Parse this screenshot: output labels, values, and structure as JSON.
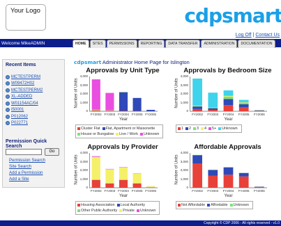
{
  "logo": {
    "text": "Your Logo"
  },
  "brand": {
    "name": "cdpsmart"
  },
  "toplinks": {
    "logoff": "Log Off",
    "separator": "|",
    "contact": "Contact Us"
  },
  "welcome": "Welcome MikeADMIN",
  "tabs": [
    "HOME",
    "SITES",
    "PERMISSIONS",
    "REPORTING",
    "DATA TRANSFER",
    "ADMINISTRATION",
    "DOCUMENTATION"
  ],
  "sidebar": {
    "recent_title": "Recent Items",
    "recent": [
      "MCTESTPERM",
      "W09472H02",
      "MCTESTPERM2",
      "XL-ADDED",
      "W01154AC/04",
      "I50001",
      "P012062",
      "P022771"
    ],
    "pqs_title": "Permission Quick Search",
    "pqs_input_value": "",
    "go_label": "Go",
    "links": [
      "Permission Search",
      "Site Search",
      "Add a Permission",
      "Add a Site"
    ]
  },
  "main": {
    "title_brand": "cdpsmart",
    "title_text": " Administrator Home Page for Islington"
  },
  "colors": {
    "nav": "#0c1e8c",
    "brand": "#1aa0e8",
    "pink": "#e94ee0",
    "blue": "#2f49b8",
    "cyan": "#3fd3ec",
    "yellow": "#f5f06a",
    "green": "#7fe07a",
    "red": "#e8413a"
  },
  "chart_data": [
    {
      "type": "bar",
      "stacked": true,
      "title": "Approvals by Unit Type",
      "xlabel": "Year",
      "ylabel": "Number of Units",
      "ylim": [
        0,
        4000
      ],
      "yticks": [
        "4,000",
        "3,000",
        "2,000",
        "1,000",
        "0"
      ],
      "categories": [
        "FY2002",
        "FY2003",
        "FY2004",
        "FY2005",
        "FY2006"
      ],
      "series": [
        {
          "name": "Cluster Flat",
          "color": "#e8413a",
          "values": [
            100,
            60,
            40,
            30,
            10
          ]
        },
        {
          "name": "Flat, Apartment or Maisonette",
          "color": "#2f49b8",
          "values": [
            0,
            0,
            2150,
            1500,
            150
          ]
        },
        {
          "name": "House or Bungalow",
          "color": "#7fe07a",
          "values": [
            50,
            40,
            30,
            20,
            10
          ]
        },
        {
          "name": "Live / Work",
          "color": "#f5f06a",
          "values": [
            20,
            10,
            10,
            10,
            0
          ]
        },
        {
          "name": "Unknown",
          "color": "#e94ee0",
          "values": [
            3500,
            2000,
            0,
            0,
            0
          ]
        }
      ]
    },
    {
      "type": "bar",
      "stacked": true,
      "title": "Approvals by Bedroom Size",
      "xlabel": "Year",
      "ylabel": "Number of Units",
      "ylim": [
        0,
        4000
      ],
      "yticks": [
        "4,000",
        "3,000",
        "2,000",
        "1,000",
        "0"
      ],
      "categories": [
        "FY2002",
        "FY2003",
        "FY2004",
        "FY2005",
        "FY2006"
      ],
      "series": [
        {
          "name": "1",
          "color": "#e8413a",
          "values": [
            250,
            150,
            700,
            450,
            50
          ]
        },
        {
          "name": "2",
          "color": "#2f49b8",
          "values": [
            300,
            200,
            700,
            350,
            40
          ]
        },
        {
          "name": "3",
          "color": "#7fe07a",
          "values": [
            80,
            60,
            300,
            200,
            20
          ]
        },
        {
          "name": "4",
          "color": "#f5f06a",
          "values": [
            20,
            20,
            80,
            50,
            10
          ]
        },
        {
          "name": "5+",
          "color": "#e94ee0",
          "values": [
            10,
            10,
            20,
            10,
            0
          ]
        },
        {
          "name": "Unknown",
          "color": "#3fd3ec",
          "values": [
            3100,
            1700,
            600,
            250,
            30
          ]
        }
      ]
    },
    {
      "type": "bar",
      "stacked": true,
      "title": "Approvals by Provider",
      "xlabel": "Year",
      "ylabel": "Number of Units",
      "ylim": [
        0,
        4000
      ],
      "yticks": [
        "4,000",
        "3,000",
        "2,000",
        "1,000",
        "0"
      ],
      "categories": [
        "FY2002",
        "FY2003",
        "FY2004",
        "FY2005",
        "FY2006"
      ],
      "series": [
        {
          "name": "Housing Association",
          "color": "#e8413a",
          "values": [
            900,
            500,
            900,
            500,
            50
          ]
        },
        {
          "name": "Local Authority",
          "color": "#2f49b8",
          "values": [
            0,
            0,
            0,
            0,
            0
          ]
        },
        {
          "name": "Other Public Authority",
          "color": "#7fe07a",
          "values": [
            50,
            30,
            40,
            20,
            10
          ]
        },
        {
          "name": "Private",
          "color": "#f5f06a",
          "values": [
            2600,
            1600,
            1400,
            1100,
            100
          ]
        },
        {
          "name": "Unknown",
          "color": "#e94ee0",
          "values": [
            80,
            40,
            40,
            30,
            10
          ]
        }
      ]
    },
    {
      "type": "bar",
      "stacked": true,
      "title": "Affordable Approvals",
      "xlabel": "Year",
      "ylabel": "Number of Units",
      "ylim": [
        0,
        4000
      ],
      "yticks": [
        "4,000",
        "3,000",
        "2,000",
        "1,000",
        "0"
      ],
      "categories": [
        "FY2002",
        "FY2003",
        "FY2004",
        "FY2005",
        "FY2006"
      ],
      "series": [
        {
          "name": "Not Affordable",
          "color": "#e8413a",
          "values": [
            2800,
            1400,
            1500,
            1300,
            100
          ]
        },
        {
          "name": "Affordable",
          "color": "#2f49b8",
          "values": [
            950,
            650,
            850,
            400,
            30
          ]
        },
        {
          "name": "Unknown",
          "color": "#7fe07a",
          "values": [
            30,
            20,
            20,
            10,
            5
          ]
        }
      ]
    }
  ]
}
